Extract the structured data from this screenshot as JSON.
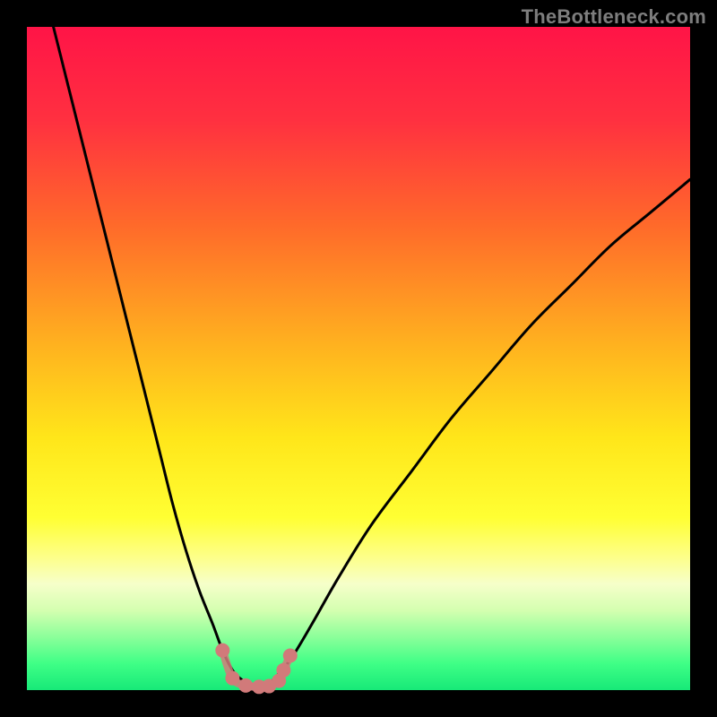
{
  "watermark": "TheBottleneck.com",
  "colors": {
    "frame": "#000000",
    "curve": "#000000",
    "marker_fill": "#d17a7a",
    "marker_stroke": "#b85a5a",
    "gradient_stops": [
      {
        "pct": 0,
        "color": "#ff1447"
      },
      {
        "pct": 14,
        "color": "#ff3040"
      },
      {
        "pct": 30,
        "color": "#ff6a2a"
      },
      {
        "pct": 48,
        "color": "#ffb21f"
      },
      {
        "pct": 62,
        "color": "#ffe61a"
      },
      {
        "pct": 74,
        "color": "#ffff33"
      },
      {
        "pct": 80,
        "color": "#fdff8a"
      },
      {
        "pct": 84,
        "color": "#f6ffca"
      },
      {
        "pct": 88,
        "color": "#d4ffb0"
      },
      {
        "pct": 92,
        "color": "#8bff9a"
      },
      {
        "pct": 96,
        "color": "#3fff86"
      },
      {
        "pct": 100,
        "color": "#17e978"
      }
    ]
  },
  "chart_data": {
    "type": "line",
    "title": "",
    "xlabel": "",
    "ylabel": "",
    "xlim": [
      0,
      100
    ],
    "ylim": [
      0,
      100
    ],
    "series": [
      {
        "name": "left-curve",
        "x": [
          4,
          6,
          8,
          10,
          12,
          14,
          16,
          18,
          20,
          22,
          24,
          26,
          28,
          29.5,
          31,
          32.5,
          34,
          35
        ],
        "y": [
          100,
          92,
          84,
          76,
          68,
          60,
          52,
          44,
          36,
          28,
          21,
          15,
          10,
          6,
          3,
          1.5,
          0.8,
          0.5
        ]
      },
      {
        "name": "right-curve",
        "x": [
          35,
          36.5,
          38,
          40,
          43,
          47,
          52,
          58,
          64,
          70,
          76,
          82,
          88,
          94,
          100
        ],
        "y": [
          0.5,
          1,
          2.5,
          5,
          10,
          17,
          25,
          33,
          41,
          48,
          55,
          61,
          67,
          72,
          77
        ]
      },
      {
        "name": "valley-markers",
        "x": [
          29.5,
          31,
          33,
          35,
          36.5,
          38,
          38.7,
          39.7
        ],
        "y": [
          6,
          1.8,
          0.7,
          0.5,
          0.6,
          1.4,
          3.0,
          5.2
        ]
      }
    ],
    "annotations": []
  }
}
